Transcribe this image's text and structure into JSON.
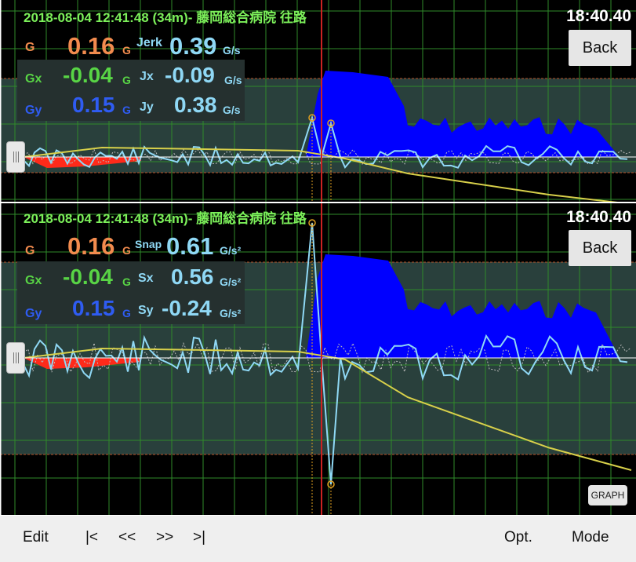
{
  "top": {
    "header": "2018-08-04 12:41:48 (34m)- 藤岡総合病院 往路",
    "clock": "18:40.40",
    "back_label": "Back",
    "rows": [
      {
        "label": "G",
        "value": "0.16",
        "unit": "G",
        "label2": "Jerk",
        "value2": "0.39",
        "unit2": "G/s"
      },
      {
        "label": "Gx",
        "value": "-0.04",
        "unit": "G",
        "label2": "Jx",
        "value2": "-0.09",
        "unit2": "G/s"
      },
      {
        "label": "Gy",
        "value": "0.15",
        "unit": "G",
        "label2": "Jy",
        "value2": "0.38",
        "unit2": "G/s"
      }
    ]
  },
  "bottom": {
    "header": "2018-08-04 12:41:48 (34m)- 藤岡総合病院 往路",
    "clock": "18:40.40",
    "back_label": "Back",
    "rows": [
      {
        "label": "G",
        "value": "0.16",
        "unit": "G",
        "label2": "Snap",
        "value2": "0.61",
        "unit2": "G/s²"
      },
      {
        "label": "Gx",
        "value": "-0.04",
        "unit": "G",
        "label2": "Sx",
        "value2": "0.56",
        "unit2": "G/s²"
      },
      {
        "label": "Gy",
        "value": "0.15",
        "unit": "G",
        "label2": "Sy",
        "value2": "-0.24",
        "unit2": "G/s²"
      }
    ],
    "graph_label": "GRAPH"
  },
  "toolbar": {
    "edit": "Edit",
    "first": "|<",
    "prev": "<<",
    "next": ">>",
    "last": ">|",
    "opt": "Opt.",
    "mode": "Mode"
  },
  "colors": {
    "header": "#7cf05a",
    "grid": "#2f8a2a",
    "g": "#f28b4e",
    "gx": "#58d445",
    "gy": "#2f5cf2",
    "jerk": "#8fd8f5",
    "fill_blue": "#0000ff",
    "fill_red": "#ff2a1a",
    "speed_line": "#d8d04a",
    "cursor": "#cc2222"
  }
}
